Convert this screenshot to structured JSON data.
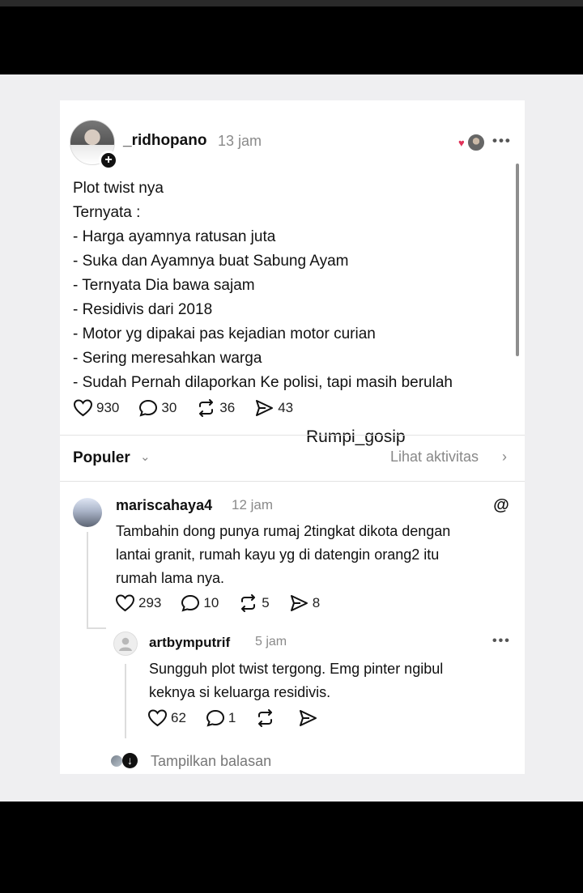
{
  "post": {
    "username": "_ridhopano",
    "time": "13 jam",
    "body_lines": [
      "Plot twist nya",
      "Ternyata :",
      "- Harga ayamnya ratusan juta",
      "- Suka dan Ayamnya buat Sabung Ayam",
      "- Ternyata Dia bawa sajam",
      "- Residivis dari 2018",
      "- Motor yg dipakai pas kejadian motor curian",
      "- Sering meresahkan warga",
      "- Sudah Pernah dilaporkan Ke polisi, tapi masih berulah"
    ],
    "stats": {
      "likes": "930",
      "comments": "30",
      "reposts": "36",
      "shares": "43"
    }
  },
  "watermark": "Rumpi_gosip",
  "sort": {
    "label": "Populer",
    "activity": "Lihat aktivitas"
  },
  "comment": {
    "username": "mariscahaya4",
    "time": "12 jam",
    "body_lines": [
      "Tambahin dong punya rumaj 2tingkat dikota dengan",
      "lantai granit, rumah kayu yg di datengin orang2 itu",
      "rumah lama nya."
    ],
    "stats": {
      "likes": "293",
      "comments": "10",
      "reposts": "5",
      "shares": "8"
    }
  },
  "reply": {
    "username": "artbymputrif",
    "time": "5 jam",
    "body_lines": [
      "Sungguh plot twist tergong. Emg pinter ngibul",
      "keknya si keluarga residivis."
    ],
    "stats": {
      "likes": "62",
      "comments": "1",
      "reposts": "",
      "shares": ""
    }
  },
  "show_replies": "Tampilkan balasan",
  "icons": {
    "like": "heart-icon",
    "comment": "comment-icon",
    "repost": "repost-icon",
    "share": "send-icon",
    "more": "more-icon",
    "threads": "threads-icon"
  }
}
